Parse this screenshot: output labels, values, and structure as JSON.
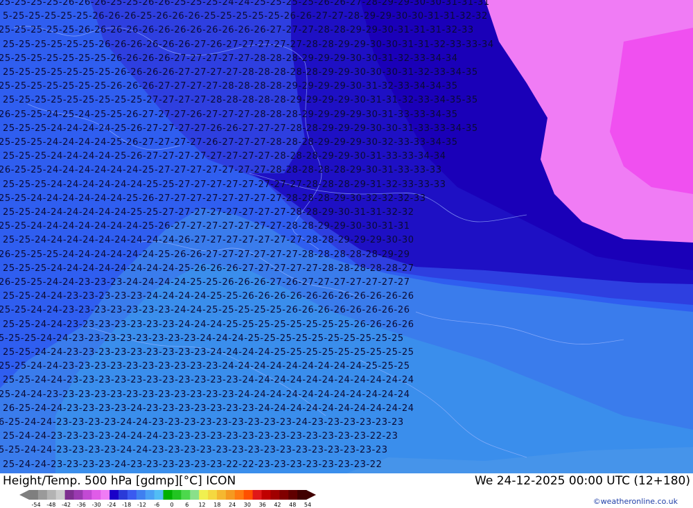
{
  "title": "Height/Temp. 500 hPa [gdmp][°C] ICON",
  "datetime": "We 24-12-2025 00:00 UTC (12+180)",
  "credit": "©weatheronline.co.uk",
  "legend": {
    "ticks": [
      "-54",
      "-48",
      "-42",
      "-36",
      "-30",
      "-24",
      "-18",
      "-12",
      "-6",
      "0",
      "6",
      "12",
      "18",
      "24",
      "30",
      "36",
      "42",
      "48",
      "54"
    ],
    "colors": [
      "#7f7f7f",
      "#9a9a9a",
      "#b3b3b3",
      "#cccccc",
      "#7d2f8f",
      "#9a3ab0",
      "#c24ad4",
      "#e05ce8",
      "#f07cf5",
      "#1a00c8",
      "#2a3ad8",
      "#3a5af0",
      "#3f7ff0",
      "#4aa0f5",
      "#52bdf5",
      "#00b000",
      "#22c422",
      "#4cd84c",
      "#8ae08a",
      "#f0f050",
      "#f5d840",
      "#f5b830",
      "#f59a20",
      "#ff7a10",
      "#ff5000",
      "#e01818",
      "#c00000",
      "#a00000",
      "#800000",
      "#600000",
      "#400000"
    ]
  },
  "map": {
    "zones": [
      {
        "value": 22,
        "color": "#4694ea"
      },
      {
        "value": 23,
        "color": "#3a8eec"
      },
      {
        "value": 24,
        "color": "#3a7cec"
      },
      {
        "value": 25,
        "color": "#2f5ef0"
      },
      {
        "value": 26,
        "color": "#2e3fe0"
      },
      {
        "value": 27,
        "color": "#1e10c4"
      },
      {
        "value": 29,
        "color": "#1a00b8"
      },
      {
        "value": 30,
        "color": "#f07cf5"
      },
      {
        "value": 33,
        "color": "#f050f0"
      }
    ],
    "label_rows": [
      "25 25 25 25 26 26 26 25 25 26 26 25 25 25 24 24 25 25 25 25 26 26 27 28 29 29 30 30 31 31 31",
      "5 25 25 25 25 25 26 26 26 25 26 26 26 25 25 25 25 25 26 26 27 27 28 29 29 30 30 31 31 32 32",
      "25 25 25 25 25 26 26 26 26 26 26 26 26 26 26 26 26 27 27 27 28 28 29 29 30 31 31 31 32 33",
      "25 25 25 25 25 25 26 26 26 26 26 26 27 26 27 27 27 27 27 28 28 29 29 30 30 31 31 32 33 33 34",
      "25 25 25 25 25 25 25 26 26 26 26 27 27 27 27 27 28 28 28 29 29 29 30 30 31 32 33 34 34",
      "25 25 25 25 25 25 25 26 26 26 26 27 27 27 27 28 28 28 28 28 29 29 30 30 30 31 32 33 34 35",
      "25 25 25 25 25 25 25 26 26 26 27 27 27 27 28 28 28 28 29 29 29 29 30 31 32 33 34 34 35",
      "25 25 25 25 25 25 25 25 25 27 27 27 27 28 28 28 28 28 29 29 29 29 30 31 31 32 33 34 35 35",
      "26 25 25 24 25 24 25 25 26 27 27 27 26 27 27 27 28 28 28 29 29 29 29 30 31 33 33 34 35",
      "25 25 25 24 24 24 24 25 26 27 27 27 27 26 26 27 27 27 28 28 29 29 29 30 30 31 33 33 34 35",
      "25 25 25 24 24 24 24 25 26 27 27 27 27 26 27 27 27 28 28 28 29 29 29 30 32 33 33 34 35",
      "25 25 25 24 24 24 24 25 26 27 27 27 27 27 27 27 27 28 28 28 29 29 30 31 33 33 34 34",
      "26 25 25 24 24 24 24 24 24 25 27 27 27 27 27 27 27 28 28 28 28 28 29 30 31 33 33 33",
      "25 25 25 24 24 24 24 24 24 25 25 27 27 27 27 27 27 27 27 28 28 28 29 31 32 33 33 33",
      "25 25 24 24 24 24 24 24 25 26 27 27 27 27 27 27 27 27 28 28 28 29 30 32 32 32 33",
      "25 25 24 24 24 24 24 24 25 25 27 27 27 27 27 27 27 27 28 28 29 30 31 31 32 32",
      "25 25 24 24 24 24 24 24 24 25 26 27 27 27 27 27 27 27 28 28 29 29 30 30 31 31",
      "25 25 24 24 24 24 24 24 24 24 24 26 27 27 27 27 27 27 27 28 28 29 29 29 30 30",
      "26 25 25 25 24 24 24 24 24 24 25 26 26 27 27 27 27 27 27 28 28 28 28 28 29 29",
      "25 25 25 24 24 24 24 24 24 24 24 25 26 26 26 27 27 27 27 27 28 28 28 28 28 27",
      "26 25 25 24 24 23 23 23 24 24 24 24 25 25 26 26 26 27 26 27 27 27 27 27 27 27",
      "25 25 24 24 23 23 23 23 23 24 24 24 24 25 25 26 26 26 26 26 26 26 26 26 26 26",
      "25 25 24 24 23 23 23 23 23 23 23 24 24 25 25 25 25 25 26 26 26 26 26 26 26 26",
      "25 25 24 24 23 23 23 23 23 23 23 24 24 24 25 25 25 25 25 25 25 25 26 26 26 26",
      "5 25 25 24 24 23 23 23 23 23 23 23 23 24 24 24 25 25 25 25 25 25 25 25 25 25",
      "25 25 24 24 23 23 23 23 23 23 23 23 23 24 24 24 24 25 25 25 25 25 25 25 25 25",
      "25 25 24 24 23 23 23 23 23 23 23 23 23 23 24 24 24 24 24 24 24 24 24 25 25 25",
      "25 25 24 24 23 23 23 23 23 23 23 23 23 23 23 24 24 24 24 24 24 24 24 24 24 24",
      "25 24 24 23 23 23 23 23 23 23 23 23 23 23 23 24 24 24 24 24 24 24 24 24 24 24",
      "26 25 24 24 23 23 23 23 24 23 23 23 23 23 23 23 24 24 24 24 24 24 24 24 24 24",
      "6 25 24 24 23 23 23 23 24 24 23 23 23 23 23 23 23 23 23 24 23 23 23 23 23 23",
      "25 24 24 23 23 23 23 24 24 24 23 23 23 23 23 23 23 23 23 23 23 23 23 22 23",
      "5 25 24 24 23 23 23 23 24 24 23 23 23 23 23 23 23 23 23 23 23 23 23 23 23",
      "25 24 24 23 23 23 23 24 23 23 23 23 23 23 22 22 23 23 23 23 23 23 23 22"
    ]
  }
}
